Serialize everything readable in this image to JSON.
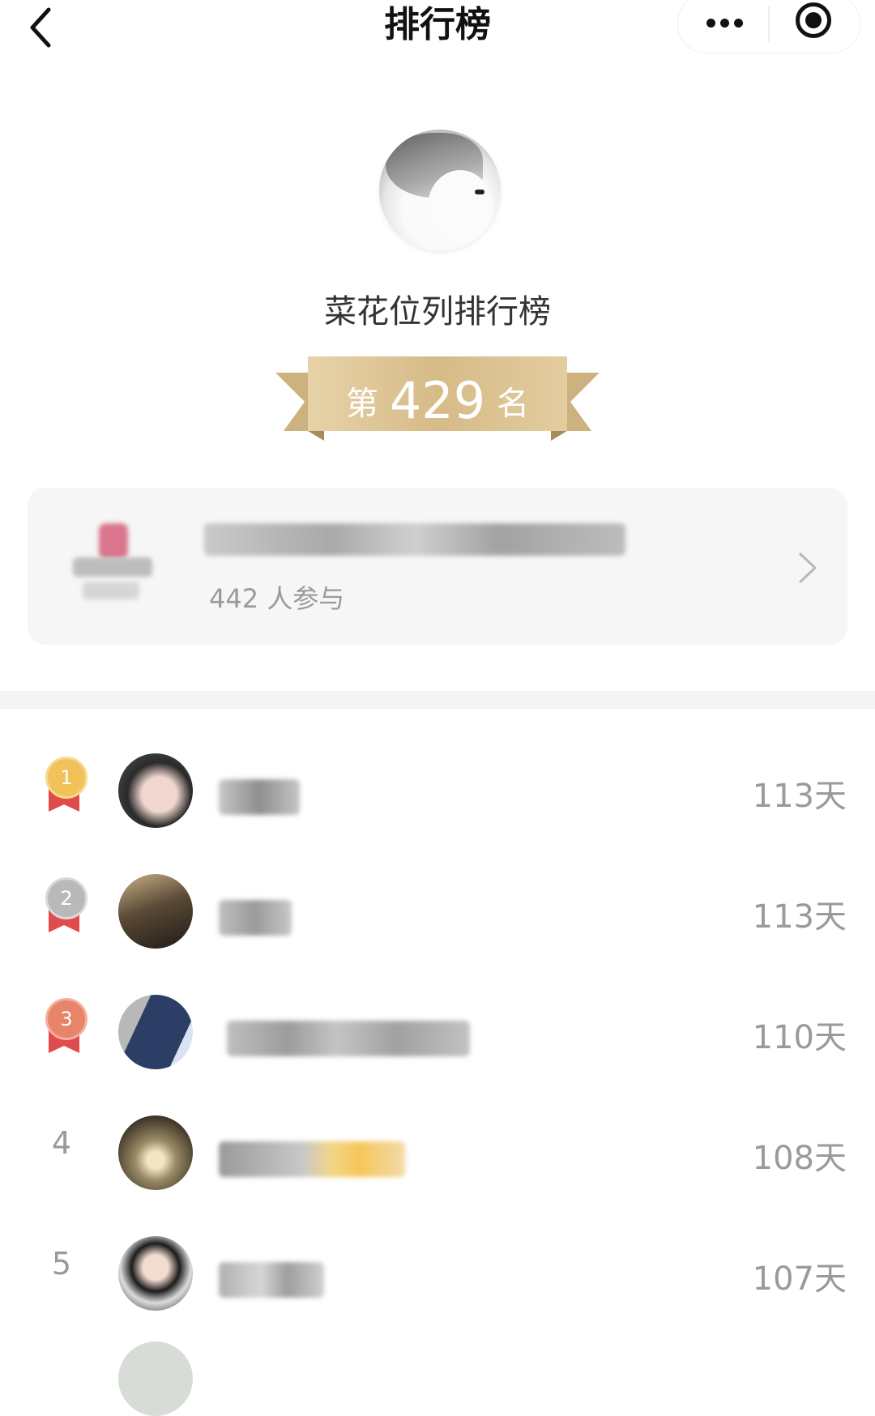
{
  "nav": {
    "title": "排行榜",
    "back_icon": "chevron-left-icon",
    "more_icon": "more-dots-icon",
    "target_icon": "record-target-icon"
  },
  "header": {
    "list_name": "菜花位列排行榜",
    "rank_prefix": "第",
    "rank_value": "429",
    "rank_suffix": "名"
  },
  "group": {
    "participants": "442 人参与"
  },
  "leaderboard": [
    {
      "rank": "1",
      "days": "113天",
      "medal": "gold"
    },
    {
      "rank": "2",
      "days": "113天",
      "medal": "silver"
    },
    {
      "rank": "3",
      "days": "110天",
      "medal": "bronze"
    },
    {
      "rank": "4",
      "days": "108天",
      "medal": ""
    },
    {
      "rank": "5",
      "days": "107天",
      "medal": ""
    }
  ],
  "colors": {
    "gold": "#f2c25a",
    "silver": "#b9b9b9",
    "bronze": "#e8846a",
    "medal_ribbon": "#e14b4b",
    "ribbon_gold": "#d9bf8e"
  }
}
